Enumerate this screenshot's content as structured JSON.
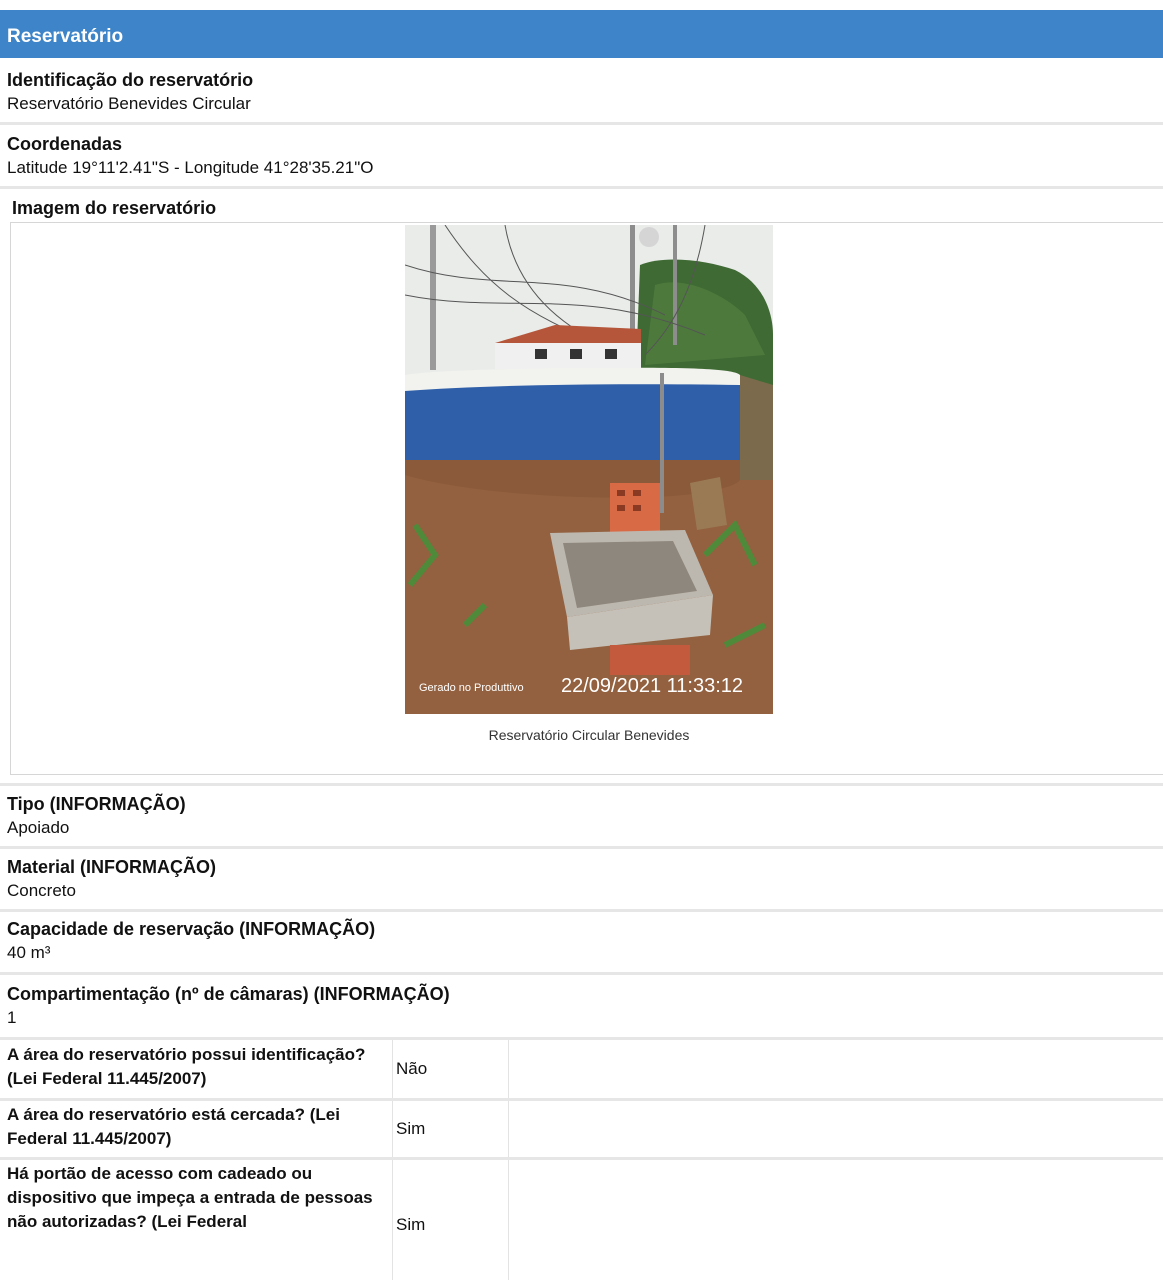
{
  "section": {
    "title": "Reservatório"
  },
  "identificacao": {
    "label": "Identificação do reservatório",
    "value": "Reservatório Benevides Circular"
  },
  "coordenadas": {
    "label": "Coordenadas",
    "value": "Latitude 19°11'2.41\"S - Longitude 41°28'35.21\"O"
  },
  "imagem": {
    "label": "Imagem do reservatório",
    "photo_watermark": "Gerado no Produttivo",
    "photo_timestamp": "22/09/2021 11:33:12",
    "caption": "Reservatório Circular Benevides"
  },
  "tipo": {
    "label": "Tipo (INFORMAÇÃO)",
    "value": "Apoiado"
  },
  "material": {
    "label": "Material (INFORMAÇÃO)",
    "value": "Concreto"
  },
  "capacidade": {
    "label": "Capacidade de reservação (INFORMAÇÃO)",
    "value": "40 m³"
  },
  "compartimentacao": {
    "label": "Compartimentação (nº de câmaras) (INFORMAÇÃO)",
    "value": "1"
  },
  "questions": [
    {
      "question": "A área do reservatório possui identificação? (Lei Federal 11.445/2007)",
      "answer": "Não"
    },
    {
      "question": "A área do reservatório está cercada? (Lei Federal 11.445/2007)",
      "answer": "Sim"
    },
    {
      "question": "Há portão de acesso com cadeado ou dispositivo que impeça a entrada de pessoas não autorizadas? (Lei Federal",
      "answer": "Sim"
    }
  ],
  "colors": {
    "header": "#3e84c8",
    "tank_blue": "#2f5fa8",
    "soil": "#8a5a3a"
  }
}
